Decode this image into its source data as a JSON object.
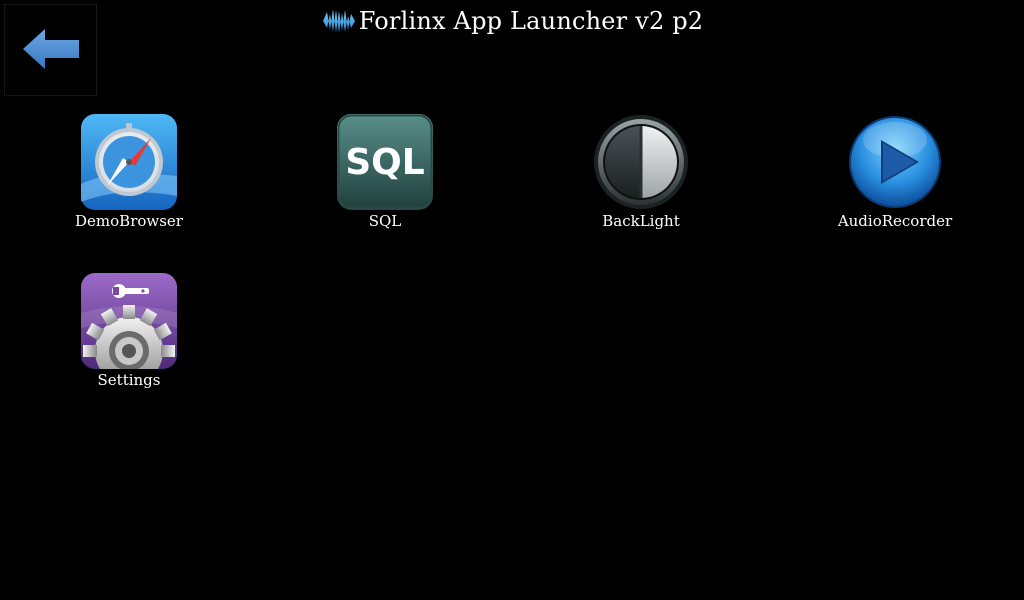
{
  "window": {
    "title": "Forlinx App Launcher v2 p2",
    "logo_icon": "forlinx-wave-logo-icon"
  },
  "back_button": {
    "icon": "back-arrow-icon",
    "color": "#4a8fd6"
  },
  "apps": [
    {
      "label": "DemoBrowser",
      "icon": "compass-browser-icon"
    },
    {
      "label": "SQL",
      "icon": "sql-icon"
    },
    {
      "label": "BackLight",
      "icon": "backlight-icon"
    },
    {
      "label": "AudioRecorder",
      "icon": "play-icon"
    },
    {
      "label": "Settings",
      "icon": "settings-gear-icon"
    }
  ],
  "colors": {
    "background": "#000000",
    "text": "#ffffff",
    "accent_blue": "#3a9ee0"
  }
}
